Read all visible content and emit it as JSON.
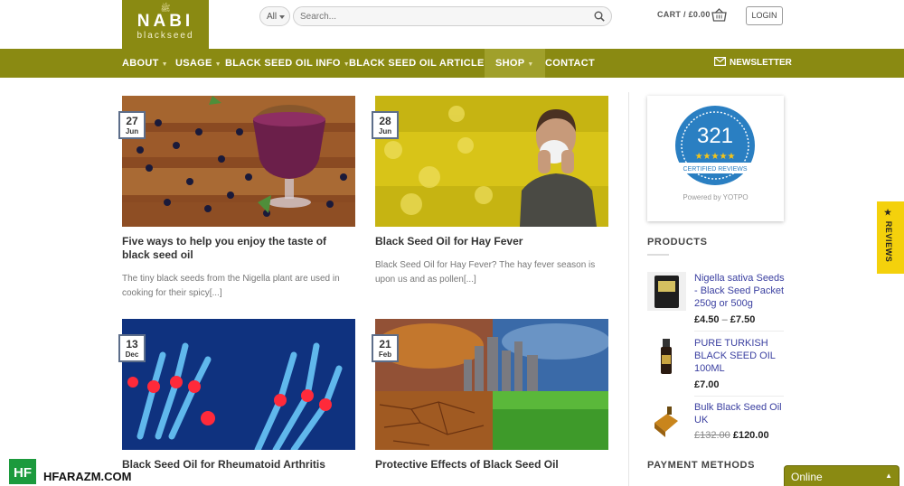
{
  "header": {
    "logo": {
      "ornament": "ﷺ",
      "brand": "NABI",
      "sub": "blackseed"
    },
    "search": {
      "category": "All",
      "placeholder": "Search..."
    },
    "cart_label": "CART / £0.00",
    "login_label": "LOGIN"
  },
  "nav": {
    "items": [
      {
        "label": "ABOUT"
      },
      {
        "label": "USAGE"
      },
      {
        "label": "BLACK SEED OIL INFO"
      },
      {
        "label": "BLACK SEED OIL ARTICLES"
      },
      {
        "label": "SHOP"
      },
      {
        "label": "CONTACT"
      }
    ],
    "newsletter": "NEWSLETTER"
  },
  "posts": [
    {
      "day": "27",
      "month": "Jun",
      "title": "Five ways to help you enjoy the taste of black seed oil",
      "excerpt": "The tiny black seeds from the Nigella plant are used in cooking for their spicy[...]"
    },
    {
      "day": "28",
      "month": "Jun",
      "title": "Black Seed Oil for Hay Fever",
      "excerpt": "Black Seed Oil for Hay Fever? The hay fever season is upon us and as pollen[...]"
    },
    {
      "day": "13",
      "month": "Dec",
      "title": "Black Seed Oil for Rheumatoid Arthritis",
      "excerpt": ""
    },
    {
      "day": "21",
      "month": "Feb",
      "title": "Protective Effects of Black Seed Oil",
      "excerpt": ""
    }
  ],
  "sidebar": {
    "yotpo": {
      "count": "321",
      "label": "CERTIFIED REVIEWS",
      "powered": "Powered by YOTPO",
      "rating": 4.5
    },
    "products_title": "PRODUCTS",
    "products": [
      {
        "name": "Nigella sativa Seeds - Black Seed Packet 250g or 500g",
        "price_low": "£4.50",
        "sep": "–",
        "price_high": "£7.50"
      },
      {
        "name": "PURE TURKISH BLACK SEED OIL 100ML",
        "price": "£7.00"
      },
      {
        "name": "Bulk Black Seed Oil UK",
        "old_price": "£132.00",
        "price": "£120.00"
      }
    ],
    "payment_title": "PAYMENT METHODS"
  },
  "reviews_tab": "★ REVIEWS",
  "chat": {
    "label": "Online"
  },
  "watermark": {
    "badge": "HF",
    "text": "HFARAZM.COM"
  },
  "colors": {
    "brand_olive": "#8a8a12",
    "reviews_yellow": "#f4d10c",
    "link_blue": "#3a3fa0",
    "badge_blue": "#2a7fc2"
  }
}
